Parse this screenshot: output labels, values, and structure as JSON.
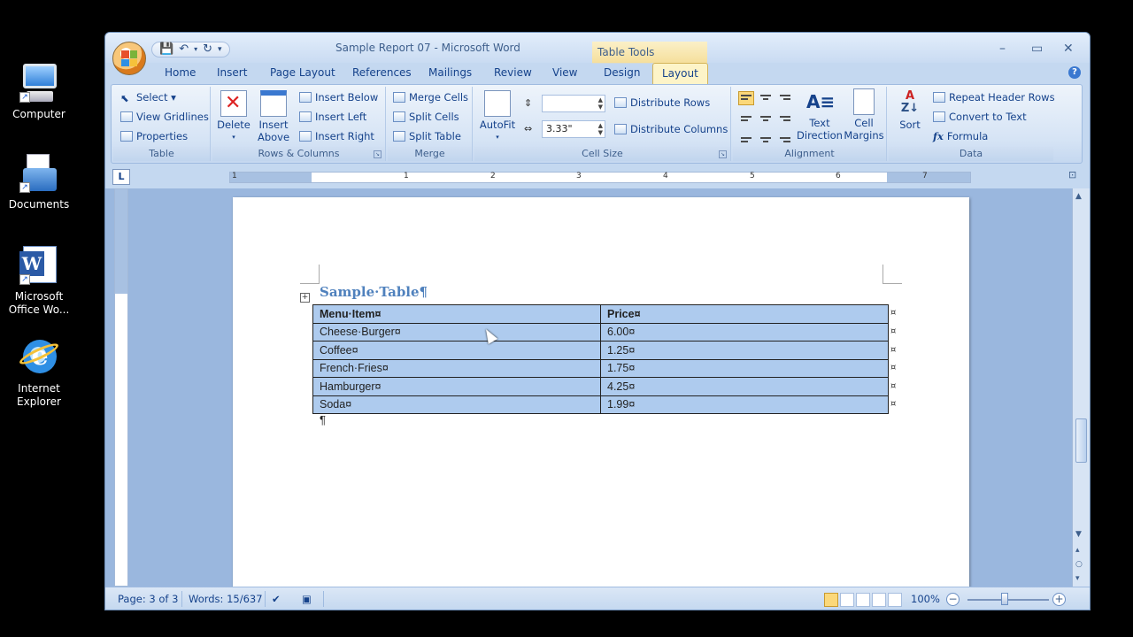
{
  "desktop": {
    "icons": [
      {
        "label": "Computer"
      },
      {
        "label": "Documents"
      },
      {
        "label_line1": "Microsoft",
        "label_line2": "Office Wo..."
      },
      {
        "label_line1": "Internet",
        "label_line2": "Explorer"
      }
    ]
  },
  "window": {
    "title": "Sample Report 07 - Microsoft Word",
    "contextual_tab_title": "Table Tools",
    "controls": {
      "minimize": "–",
      "maximize": "▭",
      "close": "✕"
    }
  },
  "ribbon_tabs": [
    "Home",
    "Insert",
    "Page Layout",
    "References",
    "Mailings",
    "Review",
    "View",
    "Design",
    "Layout"
  ],
  "active_tab": "Layout",
  "ribbon": {
    "table_group": {
      "label": "Table",
      "select": "Select ▾",
      "view_gridlines": "View Gridlines",
      "properties": "Properties"
    },
    "rows_columns_group": {
      "label": "Rows & Columns",
      "delete": "Delete",
      "insert_above_line1": "Insert",
      "insert_above_line2": "Above",
      "insert_below": "Insert Below",
      "insert_left": "Insert Left",
      "insert_right": "Insert Right"
    },
    "merge_group": {
      "label": "Merge",
      "merge_cells": "Merge Cells",
      "split_cells": "Split Cells",
      "split_table": "Split Table"
    },
    "cell_size_group": {
      "label": "Cell Size",
      "autofit": "AutoFit",
      "height_value": "",
      "width_value": "3.33\"",
      "distribute_rows": "Distribute Rows",
      "distribute_columns": "Distribute Columns"
    },
    "alignment_group": {
      "label": "Alignment",
      "text_direction_line1": "Text",
      "text_direction_line2": "Direction",
      "cell_margins_line1": "Cell",
      "cell_margins_line2": "Margins"
    },
    "data_group": {
      "label": "Data",
      "sort": "Sort",
      "repeat_header_rows": "Repeat Header Rows",
      "convert_to_text": "Convert to Text",
      "formula": "Formula"
    }
  },
  "ruler": {
    "numbers": [
      "1",
      "1",
      "2",
      "3",
      "4",
      "5",
      "6",
      "7"
    ]
  },
  "document": {
    "title": "Sample·Table¶",
    "table": {
      "header": [
        "Menu·Item¤",
        "Price¤"
      ],
      "rows": [
        [
          "Cheese·Burger¤",
          "6.00¤"
        ],
        [
          "Coffee¤",
          "1.25¤"
        ],
        [
          "French·Fries¤",
          "1.75¤"
        ],
        [
          "Hamburger¤",
          "4.25¤"
        ],
        [
          "Soda¤",
          "1.99¤"
        ]
      ],
      "end_of_row_mark": "¤"
    },
    "paragraph_mark": "¶"
  },
  "statusbar": {
    "page": "Page: 3 of 3",
    "words": "Words: 15/637",
    "zoom": "100%",
    "zoom_level_percent": 100
  }
}
